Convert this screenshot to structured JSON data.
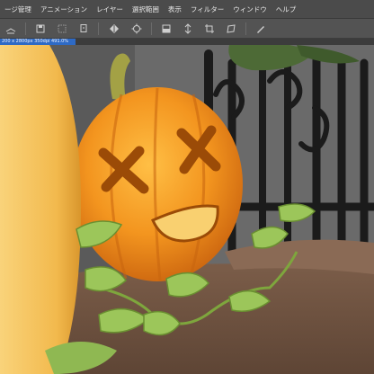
{
  "menu": {
    "items": [
      "ージ管理",
      "アニメーション",
      "レイヤー",
      "選択範囲",
      "表示",
      "フィルター",
      "ウィンドウ",
      "ヘルプ"
    ]
  },
  "toolbar": {
    "icons": [
      "layer-icon",
      "undo-history-icon",
      "layer-copy-icon",
      "flip-horizontal-icon",
      "rotate-icon",
      "color-swap-icon",
      "flip-vertical-icon",
      "transform-icon",
      "pen-icon"
    ]
  },
  "document": {
    "tab_label": "200 x 2800px 350dpi 491.0%"
  },
  "colors": {
    "menubar_bg": "#4b4b4b",
    "toolbar_bg": "#535353",
    "tab_active": "#2e6ac5",
    "pumpkin": "#f08a1c",
    "leaf": "#9cc65a"
  }
}
